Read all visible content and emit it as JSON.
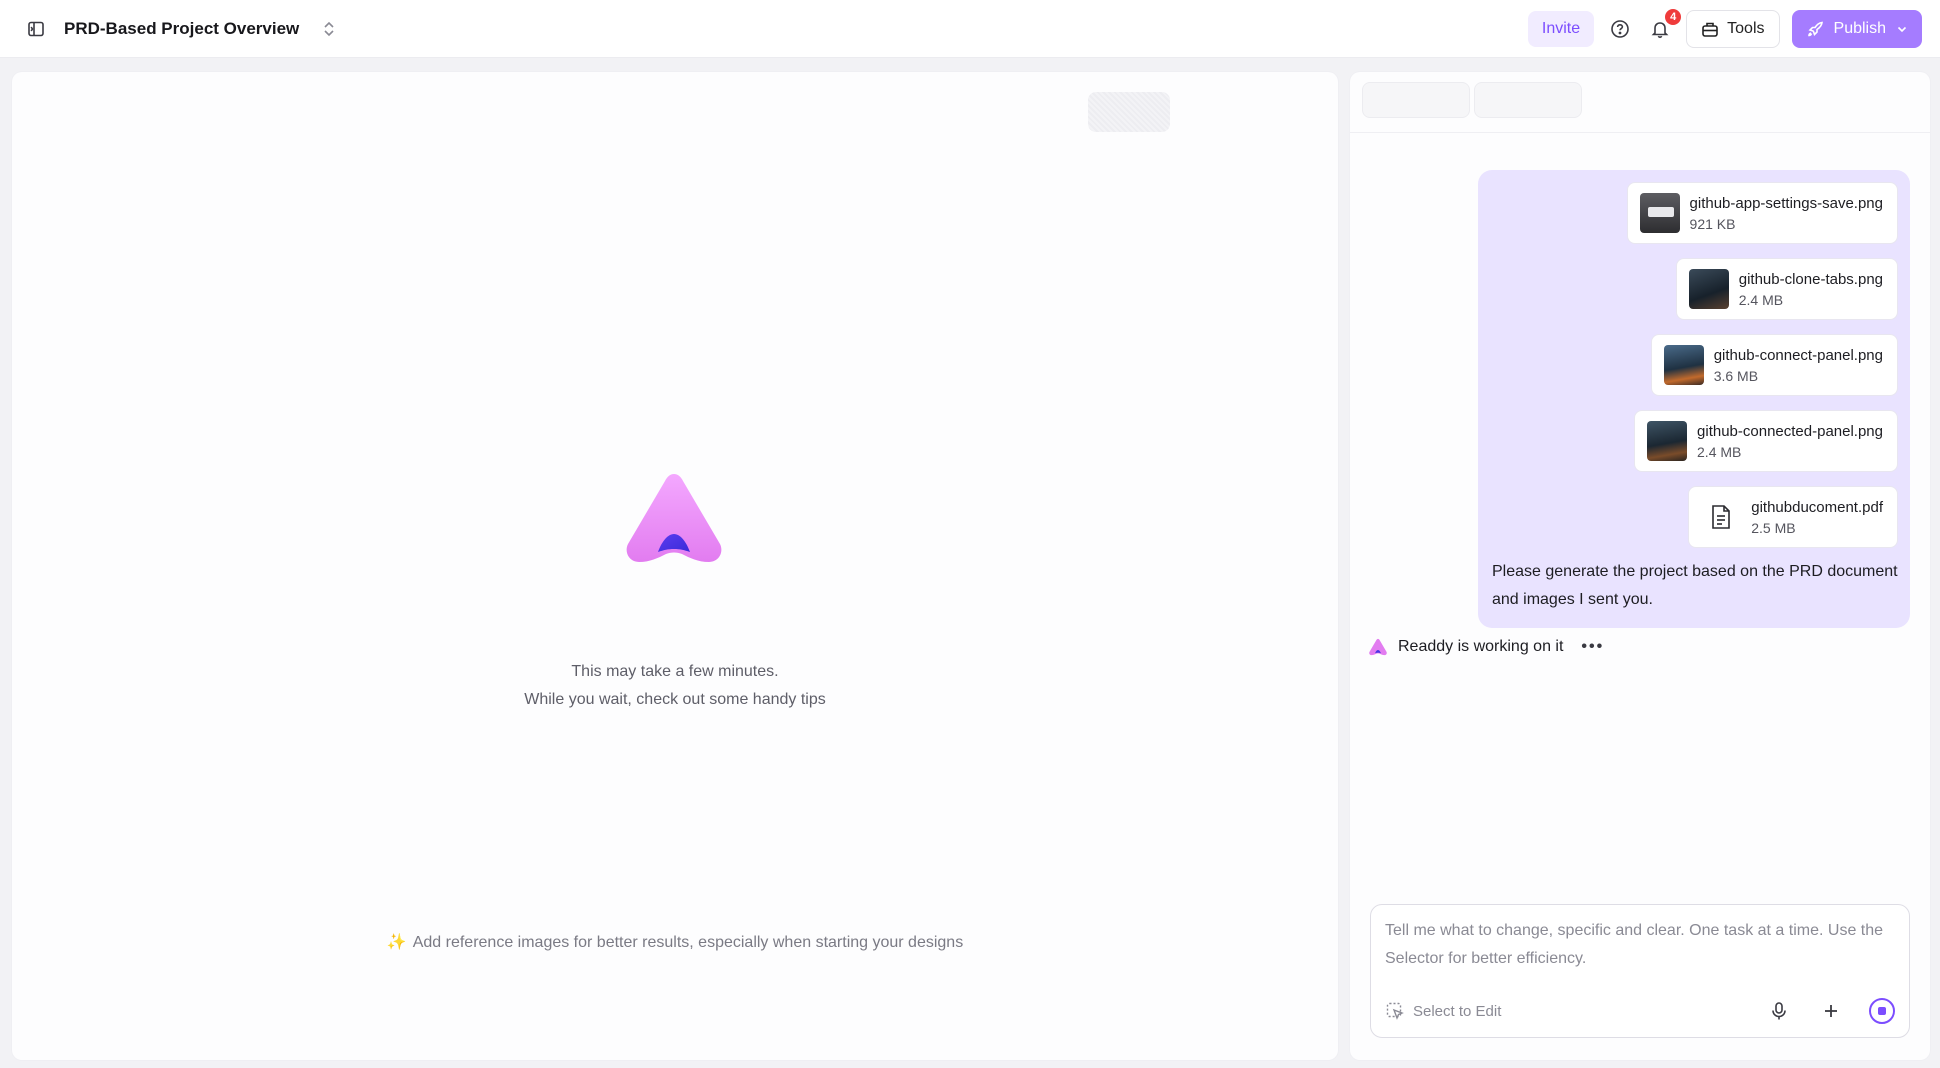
{
  "header": {
    "project_title": "PRD-Based Project Overview",
    "invite_label": "Invite",
    "notification_count": "4",
    "tools_label": "Tools",
    "publish_label": "Publish"
  },
  "canvas": {
    "wait_line1": "This may take a few minutes.",
    "wait_line2": "While you wait, check out some handy tips",
    "tip": "Add reference images for better results, especially when starting your designs"
  },
  "chat": {
    "attachments": [
      {
        "name": "github-app-settings-save.png",
        "size": "921 KB"
      },
      {
        "name": "github-clone-tabs.png",
        "size": "2.4 MB"
      },
      {
        "name": "github-connect-panel.png",
        "size": "3.6 MB"
      },
      {
        "name": "github-connected-panel.png",
        "size": "2.4 MB"
      },
      {
        "name": "githubducoment.pdf",
        "size": "2.5 MB"
      }
    ],
    "user_message": "Please generate the project based on the PRD document and images I sent you.",
    "status": "Readdy is working on it",
    "composer_placeholder": "Tell me what to change, specific and clear. One task at a time. Use the Selector for better efficiency.",
    "select_to_edit": "Select to Edit"
  },
  "colors": {
    "accent": "#7c4dff",
    "publish_bg": "#a57cff",
    "user_bubble": "#e9e3ff",
    "badge": "#ef3b3b"
  }
}
